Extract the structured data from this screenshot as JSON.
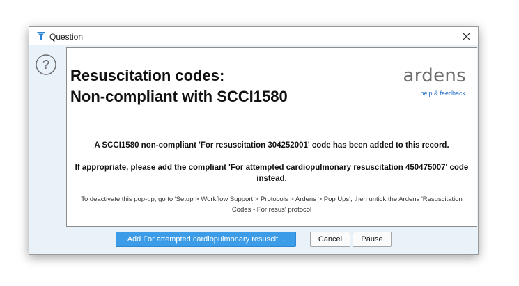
{
  "window": {
    "title": "Question",
    "title_icon": "filter-funnel-icon",
    "close_label": "×"
  },
  "side": {
    "icon": "question-circle-icon"
  },
  "content": {
    "heading_line1": "Resuscitation codes:",
    "heading_line2": "Non-compliant with SCCI1580",
    "brand": "ardens",
    "help_link": "help & feedback",
    "message1": "A SCCI1580 non-compliant 'For resuscitation 304252001' code has been added to this record.",
    "message2": "If appropriate, please add the compliant 'For attempted cardiopulmonary resuscitation 450475007' code instead.",
    "note": "To deactivate this pop-up, go to 'Setup > Workflow Support > Protocols > Ardens > Pop Ups', then untick the Ardens 'Resuscitation Codes - For resus' protocol"
  },
  "buttons": {
    "primary_label": "Add For attempted cardiopulmonary resuscit...",
    "cancel_label": "Cancel",
    "pause_label": "Pause"
  },
  "colors": {
    "dialog_bg": "#e9f1f9",
    "primary_button": "#3d9ce8",
    "link": "#1f6fc8",
    "brand_text": "#6e6e6e"
  }
}
